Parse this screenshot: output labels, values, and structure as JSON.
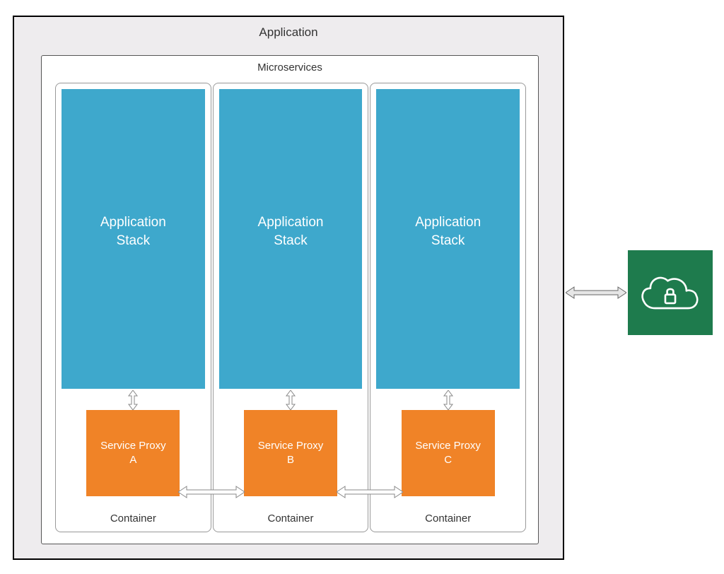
{
  "application": {
    "title": "Application"
  },
  "microservices": {
    "title": "Microservices"
  },
  "containers": [
    {
      "stack_label": "Application\nStack",
      "proxy_label": "Service Proxy\nA",
      "caption": "Container"
    },
    {
      "stack_label": "Application\nStack",
      "proxy_label": "Service Proxy\nB",
      "caption": "Container"
    },
    {
      "stack_label": "Application\nStack",
      "proxy_label": "Service Proxy\nC",
      "caption": "Container"
    }
  ],
  "external": {
    "icon_name": "cloud-lock"
  },
  "colors": {
    "app_bg": "#eeecee",
    "stack": "#3ea8cc",
    "proxy": "#f08327",
    "cloud_box": "#1e7b4d"
  }
}
